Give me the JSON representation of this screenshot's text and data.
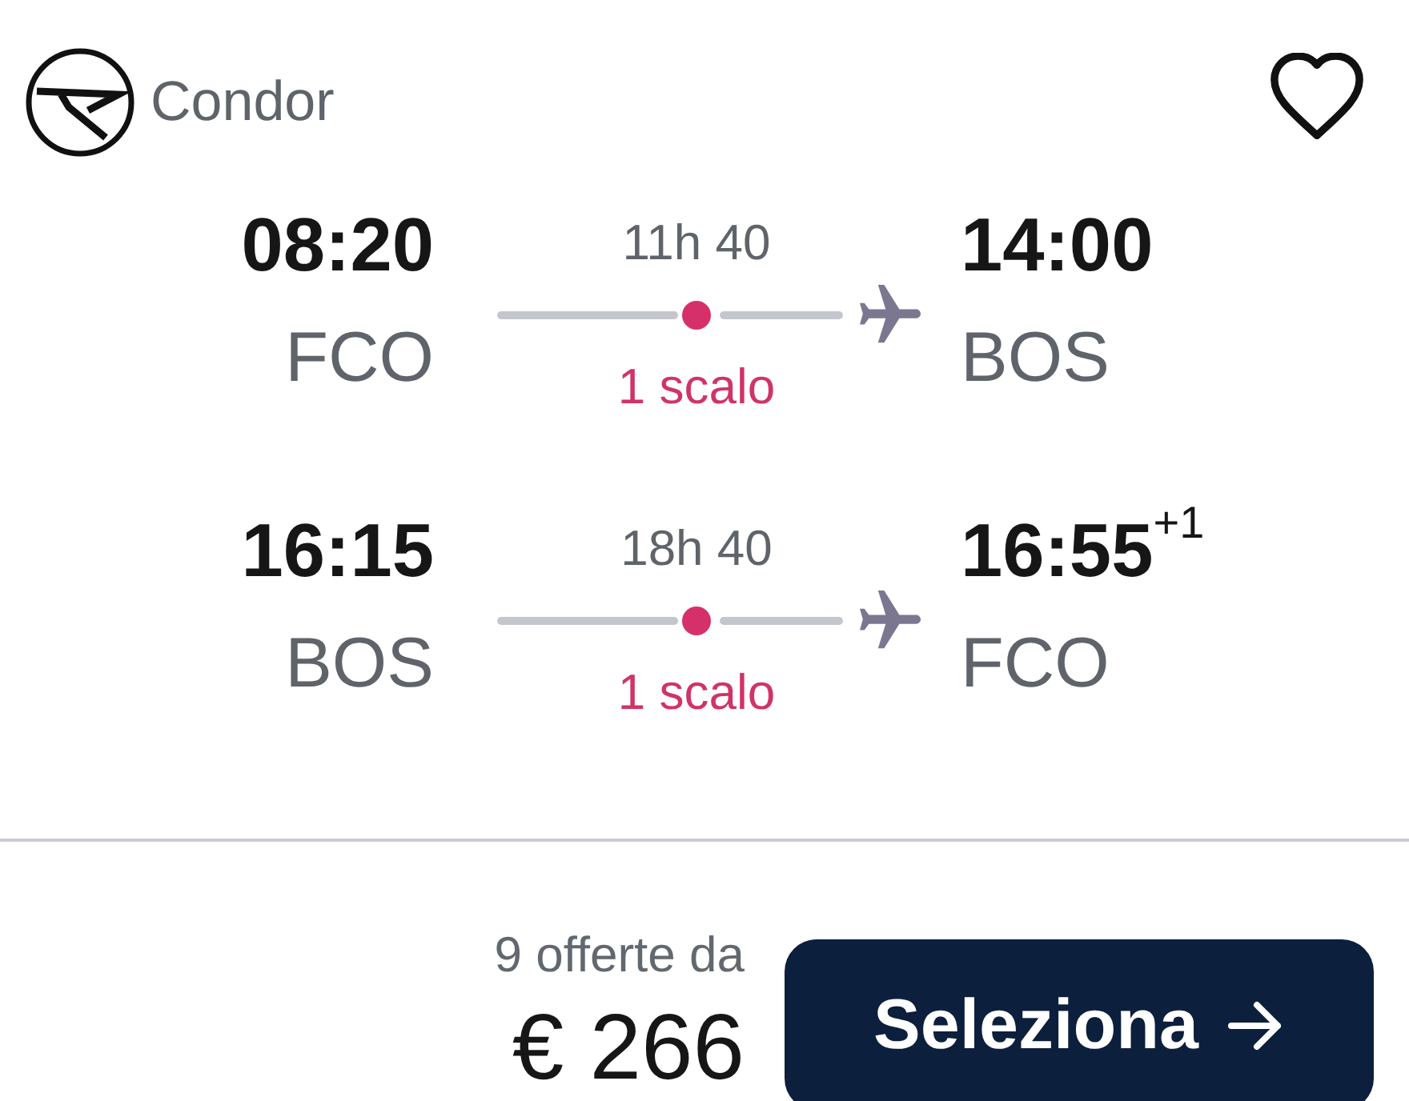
{
  "carrier": {
    "name": "Condor"
  },
  "favorite": {
    "saved": false
  },
  "legs": [
    {
      "departure": {
        "time": "08:20",
        "airport": "FCO"
      },
      "duration": "11h 40",
      "stops": "1 scalo",
      "arrival": {
        "time": "14:00",
        "airport": "BOS"
      }
    },
    {
      "departure": {
        "time": "16:15",
        "airport": "BOS"
      },
      "duration": "18h 40",
      "stops": "1 scalo",
      "arrival": {
        "time": "16:55",
        "day_offset": "+1",
        "airport": "FCO"
      }
    }
  ],
  "price": {
    "offers": "9 offerte da",
    "amount": "€ 266"
  },
  "select_button": {
    "label": "Seleziona"
  }
}
